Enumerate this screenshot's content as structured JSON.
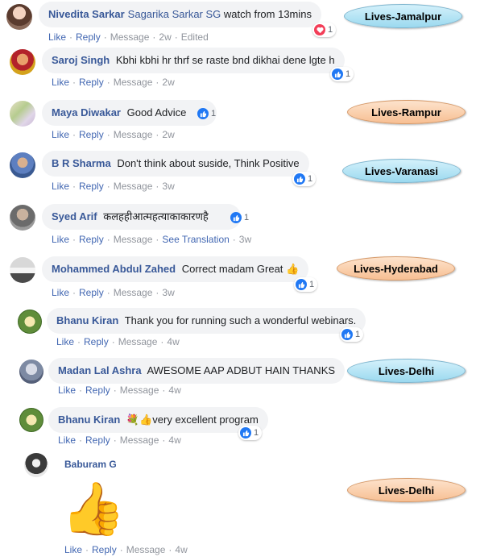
{
  "actions": {
    "like": "Like",
    "reply": "Reply",
    "message": "Message",
    "edited": "Edited",
    "see_translation": "See Translation"
  },
  "comments": [
    {
      "author": "Nivedita Sarkar",
      "mention": "Sagarika Sarkar SG",
      "text": "watch from 13mins",
      "time": "2w",
      "reaction": "love",
      "count": "1"
    },
    {
      "author": "Saroj Singh",
      "text": "Kbhi kbhi hr thrf se raste bnd dikhai dene lgte h",
      "time": "2w",
      "reaction": "like",
      "count": "1"
    },
    {
      "author": "Maya Diwakar",
      "text": "Good Advice",
      "time": "2w",
      "reaction": "like",
      "count": "1"
    },
    {
      "author": "B R Sharma",
      "text": "Don't think about suside, Think Positive",
      "time": "3w",
      "reaction": "like",
      "count": "1"
    },
    {
      "author": "Syed Arif",
      "text": "कलहहीआत्महत्याकाकारणहै",
      "time": "3w",
      "reaction": "like",
      "count": "1"
    },
    {
      "author": "Mohammed Abdul Zahed",
      "text": "Correct madam Great 👍",
      "time": "3w",
      "reaction": "like",
      "count": "1"
    },
    {
      "author": "Bhanu Kiran",
      "text": "Thank you for running such a wonderful webinars.",
      "time": "4w",
      "reaction": "like",
      "count": "1"
    },
    {
      "author": "Madan Lal Ashra",
      "text": "AWESOME AAP ADBUT HAIN THANKS",
      "time": "4w"
    },
    {
      "author": "Bhanu Kiran",
      "text": "💐👍very excellent program",
      "time": "4w",
      "reaction": "like",
      "count": "1"
    },
    {
      "author": "Baburam G",
      "sticker": "👍",
      "time": "4w"
    }
  ],
  "tags": [
    {
      "label": "Lives-Jamalpur",
      "color": "blue"
    },
    {
      "label": "Lives-Rampur",
      "color": "orange"
    },
    {
      "label": "Lives-Varanasi",
      "color": "blue"
    },
    {
      "label": "Lives-Hyderabad",
      "color": "orange"
    },
    {
      "label": "Lives-Delhi",
      "color": "blue"
    },
    {
      "label": "Lives-Delhi",
      "color": "orange"
    }
  ],
  "colors": {
    "link": "#385898",
    "action": "#4267b2",
    "bubble": "#f2f3f5",
    "like": "#2078f4",
    "love": "#f33e58"
  }
}
